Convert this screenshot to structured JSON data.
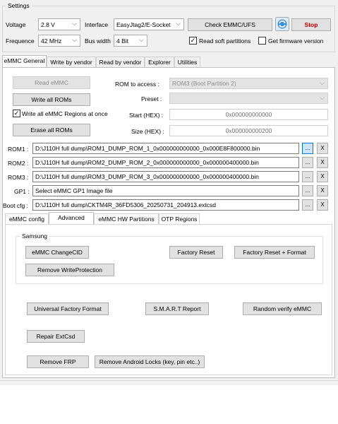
{
  "settings": {
    "title": "Settings",
    "voltage_label": "Voltage",
    "voltage_value": "2.8 V",
    "interface_label": "Interface",
    "interface_value": "EasyJtag2/E-Socket",
    "frequence_label": "Frequence",
    "frequence_value": "42 MHz",
    "bus_width_label": "Bus width",
    "bus_width_value": "4 Bit",
    "check_button": "Check EMMC/UFS",
    "stop_button": "Stop",
    "read_soft_partitions": "Read soft partitions",
    "read_soft_checked": true,
    "get_firmware_version": "Get firmware version",
    "get_firmware_checked": false
  },
  "main_tabs": [
    "eMMC General",
    "Write by vendor",
    "Read by vendor",
    "Explorer",
    "Utilities"
  ],
  "general": {
    "read_emmc": "Read eMMC",
    "write_all_roms": "Write all ROMs",
    "write_all_regions": "Write all eMMC Regions at once",
    "write_all_regions_checked": true,
    "erase_all_roms": "Erase all ROMs",
    "rom_to_access_label": "ROM to access :",
    "rom_to_access_value": "ROM3 (Boot Partition 2)",
    "preset_label": "Preset :",
    "preset_value": "",
    "start_label": "Start (HEX) :",
    "start_value": "0x000000000000",
    "size_label": "Size (HEX) :",
    "size_value": "0x000000000200"
  },
  "files": [
    {
      "label": "ROM1 :",
      "path": "D:\\J110H full dump\\ROM1_DUMP_ROM_1_0x000000000000_0x000E8F800000.bin"
    },
    {
      "label": "ROM2 :",
      "path": "D:\\J110H full dump\\ROM2_DUMP_ROM_2_0x000000000000_0x000000400000.bin"
    },
    {
      "label": "ROM3 :",
      "path": "D:\\J110H full dump\\ROM3_DUMP_ROM_3_0x000000000000_0x000000400000.bin"
    },
    {
      "label": "GP1 :",
      "path": "Select eMMC GP1 Image file"
    },
    {
      "label": "Boot cfg :",
      "path": "D:\\J110H full dump\\CKTM4R_36FD5306_20250731_204913.extcsd"
    }
  ],
  "browse_label": "...",
  "clear_label": "X",
  "sub_tabs": [
    "eMMC config",
    "Advanced",
    "eMMC HW Partitions",
    "OTP Regions"
  ],
  "advanced": {
    "samsung_title": "Samsung",
    "change_cid": "eMMC ChangeCID",
    "factory_reset": "Factory Reset",
    "factory_reset_format": "Factory Reset + Format",
    "remove_wp": "Remove WriteProtection",
    "universal_factory_format": "Universal Factory Format",
    "smart_report": "S.M.A.R.T Report",
    "random_verify": "Random verify eMMC",
    "repair_extcsd": "Repair ExtCsd",
    "remove_frp": "Remove FRP",
    "remove_android_locks": "Remove Android Locks (key, pin etc..)"
  }
}
